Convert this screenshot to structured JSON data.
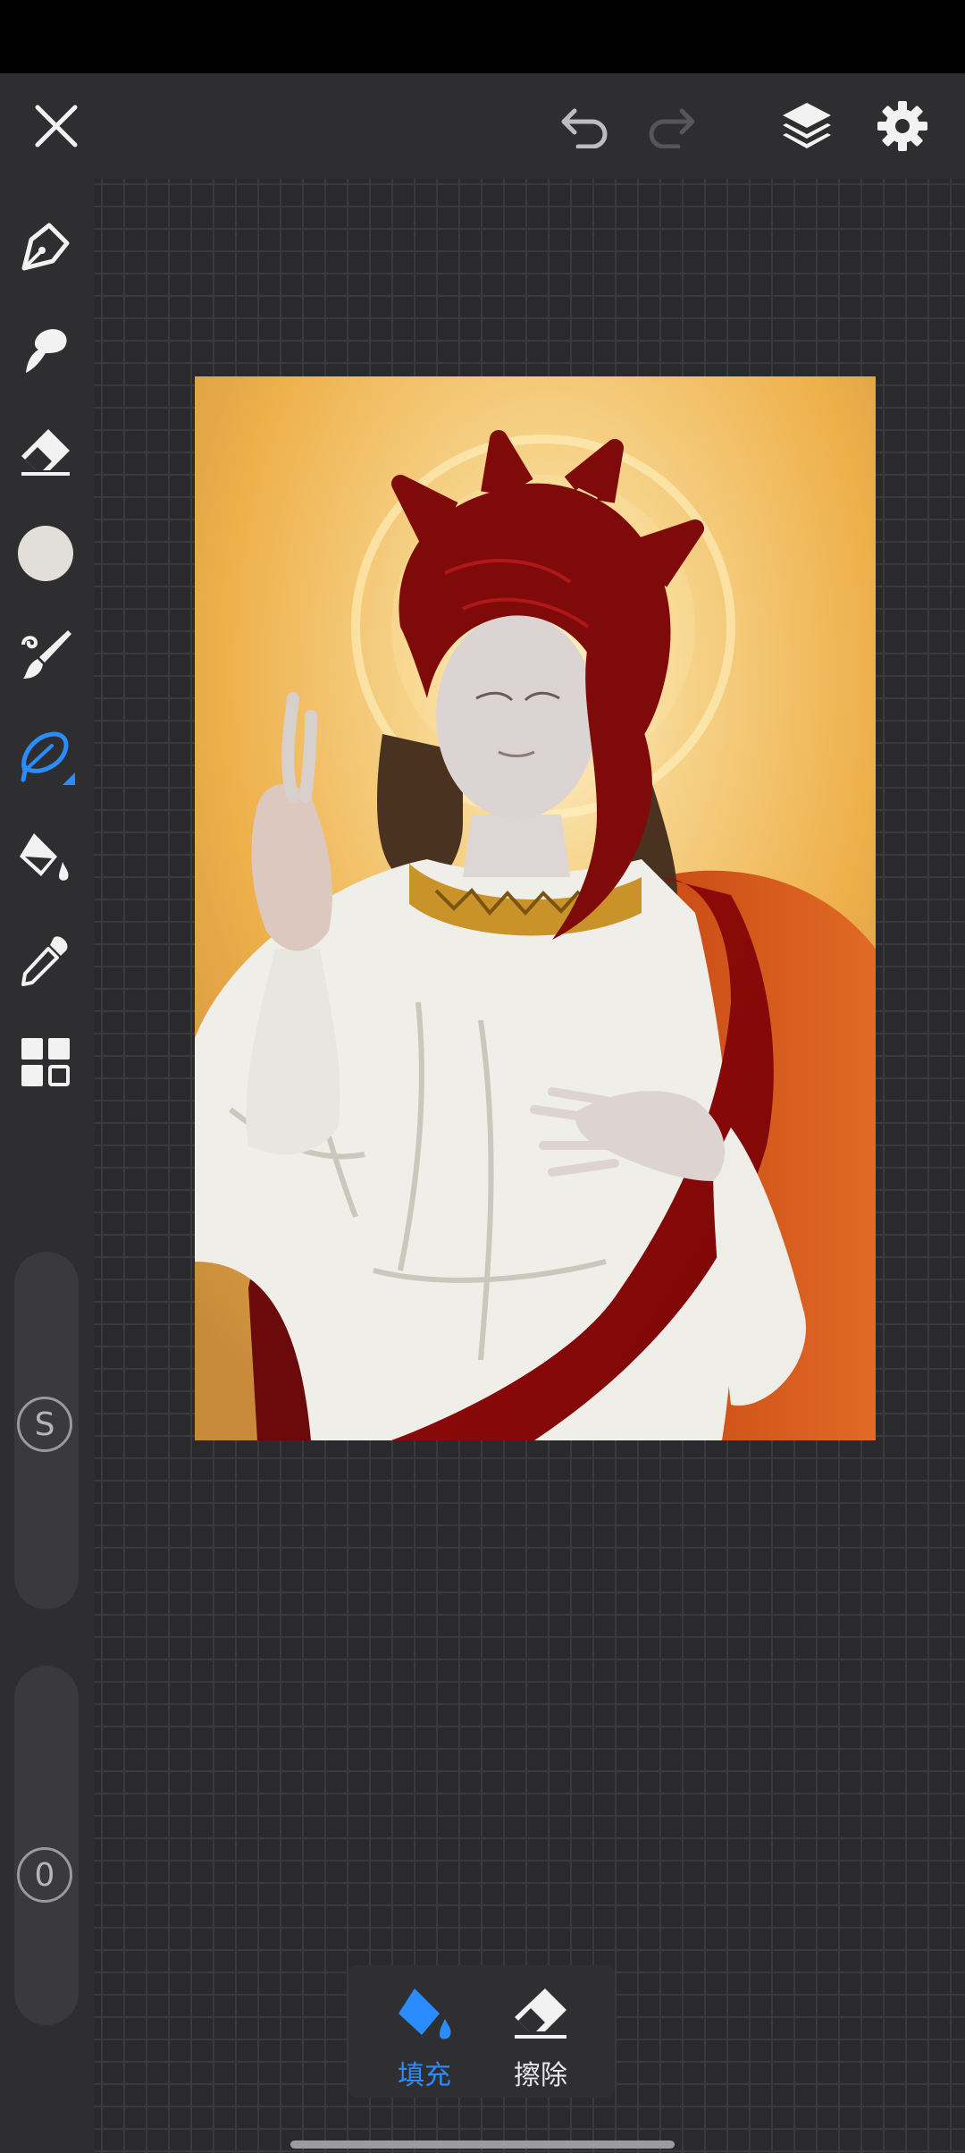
{
  "top_bar": {
    "close_icon": "close-icon",
    "undo_icon": "undo-icon",
    "redo_icon": "redo-icon",
    "layers_icon": "layers-icon",
    "settings_icon": "gear-icon"
  },
  "tools": [
    {
      "name": "pen-tool",
      "icon": "pen-nib-icon",
      "active": false
    },
    {
      "name": "smudge-tool",
      "icon": "smudge-icon",
      "active": false
    },
    {
      "name": "eraser-tool",
      "icon": "eraser-icon",
      "active": false
    },
    {
      "name": "color-picker",
      "icon": "color-circle-icon",
      "active": false
    },
    {
      "name": "brush-tool",
      "icon": "brush-icon",
      "active": false
    },
    {
      "name": "lasso-tool",
      "icon": "lasso-icon",
      "active": true
    },
    {
      "name": "fill-tool",
      "icon": "paint-bucket-icon",
      "active": false
    },
    {
      "name": "eyedropper-tool",
      "icon": "eyedropper-icon",
      "active": false
    },
    {
      "name": "more-tools",
      "icon": "grid-icon",
      "active": false
    }
  ],
  "sliders": {
    "size_label": "S",
    "opacity_label": "0"
  },
  "bottom_panel": {
    "fill_label": "填充",
    "erase_label": "擦除"
  },
  "colors": {
    "accent": "#2a8cff",
    "current_color": "#e2dfd8",
    "icon": "#f4f4f4",
    "toolbar_bg": "#2e2e30"
  }
}
